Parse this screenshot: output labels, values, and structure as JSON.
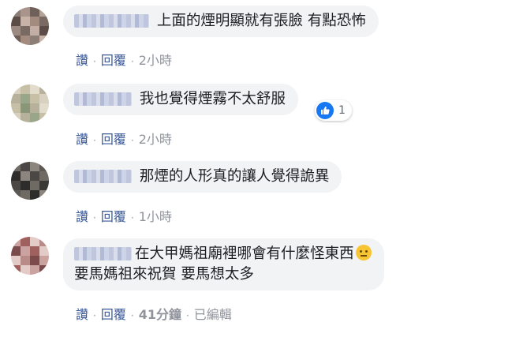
{
  "comments": [
    {
      "text": "上面的煙明顯就有張臉 有點恐怖",
      "like": "讚",
      "reply": "回覆",
      "time": "2小時",
      "avatar_colors": [
        "#7a6a64",
        "#a38b80",
        "#5b4c47",
        "#c7b3a8"
      ]
    },
    {
      "text": "我也覺得煙霧不太舒服",
      "like": "讚",
      "reply": "回覆",
      "time": "2小時",
      "reaction_count": "1",
      "avatar_colors": [
        "#c8c0a6",
        "#9aa68a",
        "#d8d0c0",
        "#b7b09a"
      ]
    },
    {
      "text": "那煙的人形真的讓人覺得詭異",
      "like": "讚",
      "reply": "回覆",
      "time": "1小時",
      "avatar_colors": [
        "#4a4744",
        "#6f6a64",
        "#2f2d2b",
        "#8b857d"
      ]
    },
    {
      "text_line1": "在大甲媽祖廟裡哪會有什麼怪東西",
      "text_line2": "要馬媽祖來祝賀 要馬想太多",
      "like": "讚",
      "reply": "回覆",
      "time": "41分鐘",
      "edited": "已編輯",
      "avatar_colors": [
        "#a0605e",
        "#caa3a0",
        "#7b4a4b",
        "#e3ccc8"
      ]
    }
  ],
  "colors": {
    "bubble": "#f2f3f5",
    "link": "#385898",
    "meta": "#90949c",
    "like_blue": "#1877f2"
  },
  "icons": [
    "like-icon",
    "neutral-face-emoji"
  ]
}
